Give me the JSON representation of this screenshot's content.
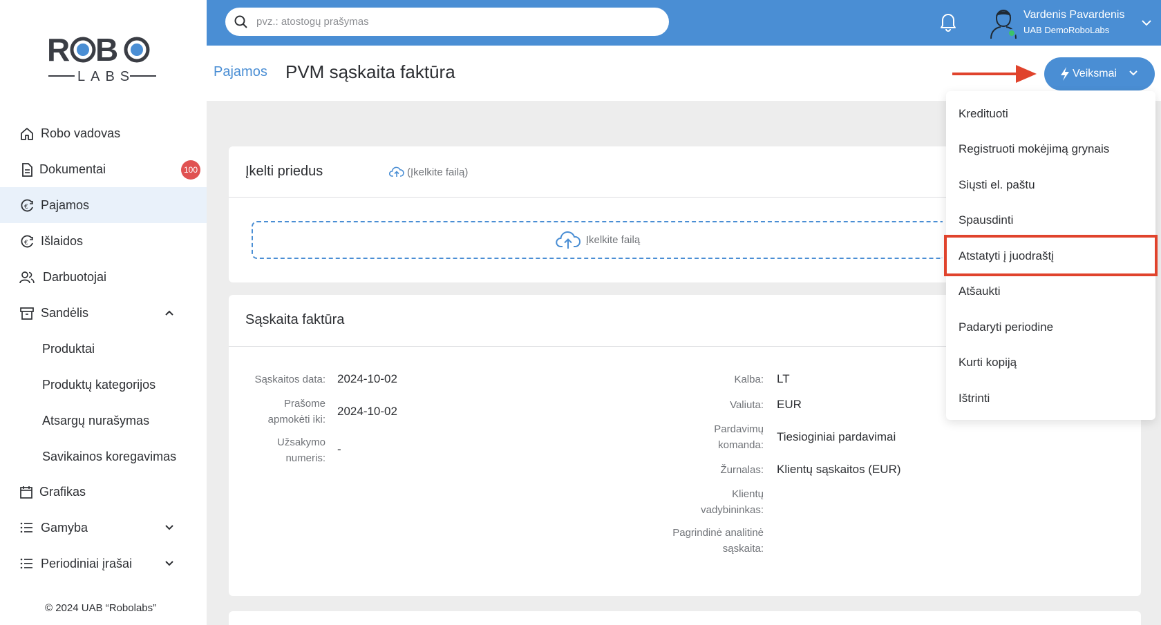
{
  "app": {
    "logo_text": "ROBO LABS",
    "accent_color": "#4a8ed4",
    "badge_color": "#e05252",
    "highlight_color": "#e0432c"
  },
  "sidebar": {
    "items": [
      {
        "label": "Robo vadovas",
        "icon": "home-icon"
      },
      {
        "label": "Dokumentai",
        "icon": "document-icon",
        "badge": "100"
      },
      {
        "label": "Pajamos",
        "icon": "euro-circle-icon",
        "active": true
      },
      {
        "label": "Išlaidos",
        "icon": "euro-circle-icon"
      },
      {
        "label": "Darbuotojai",
        "icon": "users-icon"
      },
      {
        "label": "Sandėlis",
        "icon": "archive-icon",
        "expanded": true
      },
      {
        "label": "Produktai"
      },
      {
        "label": "Produktų kategorijos"
      },
      {
        "label": "Atsargų nurašymas"
      },
      {
        "label": "Savikainos koregavimas"
      },
      {
        "label": "Grafikas",
        "icon": "calendar-icon"
      },
      {
        "label": "Gamyba",
        "icon": "list-icon",
        "expanded": false
      },
      {
        "label": "Periodiniai įrašai",
        "icon": "list-icon",
        "expanded": false
      }
    ],
    "copyright": "© 2024 UAB “Robolabs”"
  },
  "topbar": {
    "search_placeholder": "pvz.: atostogų prašymas",
    "user_name": "Vardenis Pavardenis",
    "user_company": "UAB DemoRoboLabs"
  },
  "header": {
    "breadcrumb": "Pajamos",
    "title": "PVM sąskaita faktūra",
    "actions_label": "Veiksmai"
  },
  "attachments": {
    "title": "Įkelti priedus",
    "upload_link": "(Įkelkite failą)",
    "dropzone_label": "Įkelkite failą"
  },
  "invoice": {
    "title": "Sąskaita faktūra",
    "left_fields": [
      {
        "label": "Sąskaitos data:",
        "value": "2024-10-02"
      },
      {
        "label": "Prašome apmokėti iki:",
        "value": "2024-10-02"
      },
      {
        "label": "Užsakymo numeris:",
        "value": "-"
      }
    ],
    "right_fields": [
      {
        "label": "Kalba:",
        "value": "LT"
      },
      {
        "label": "Valiuta:",
        "value": "EUR"
      },
      {
        "label": "Pardavimų komanda:",
        "value": "Tiesioginiai pardavimai"
      },
      {
        "label": "Žurnalas:",
        "value": "Klientų sąskaitos (EUR)"
      },
      {
        "label": "Klientų vadybininkas:",
        "value": ""
      },
      {
        "label": "Pagrindinė analitinė sąskaita:",
        "value": ""
      }
    ]
  },
  "actions_menu": {
    "items": [
      "Kredituoti",
      "Registruoti mokėjimą grynais",
      "Siųsti el. paštu",
      "Spausdinti",
      "Atstatyti į juodraštį",
      "Atšaukti",
      "Padaryti periodine",
      "Kurti kopiją",
      "Ištrinti"
    ],
    "highlighted": "Atstatyti į juodraštį"
  }
}
